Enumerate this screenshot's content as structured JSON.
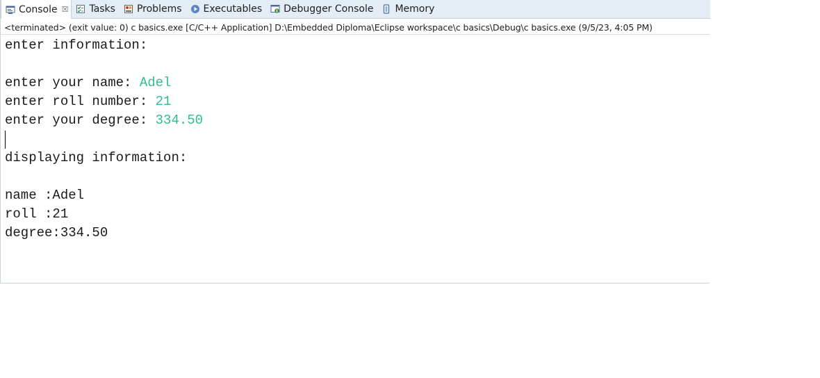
{
  "tabs": [
    {
      "label": "Console",
      "icon": "console-icon",
      "active": true,
      "close": "☒"
    },
    {
      "label": "Tasks",
      "icon": "tasks-icon"
    },
    {
      "label": "Problems",
      "icon": "problems-icon"
    },
    {
      "label": "Executables",
      "icon": "executables-icon"
    },
    {
      "label": "Debugger Console",
      "icon": "debugger-console-icon"
    },
    {
      "label": "Memory",
      "icon": "memory-icon"
    }
  ],
  "status": "<terminated> (exit value: 0) c basics.exe [C/C++ Application] D:\\Embedded Diploma\\Eclipse workspace\\c basics\\Debug\\c basics.exe (9/5/23, 4:05 PM)",
  "console": {
    "line1": "enter information:",
    "name_prompt": "enter your name: ",
    "name_value": "Adel",
    "roll_prompt": "enter roll number: ",
    "roll_value": "21",
    "degree_prompt": "enter your degree: ",
    "degree_value": "334.50",
    "display_header": "displaying information:",
    "out_name": "name :Adel",
    "out_roll": "roll :21",
    "out_degree": "degree:334.50"
  },
  "colors": {
    "user_input": "#2fbf8f",
    "tabbar_bg": "#e4ecf5"
  }
}
